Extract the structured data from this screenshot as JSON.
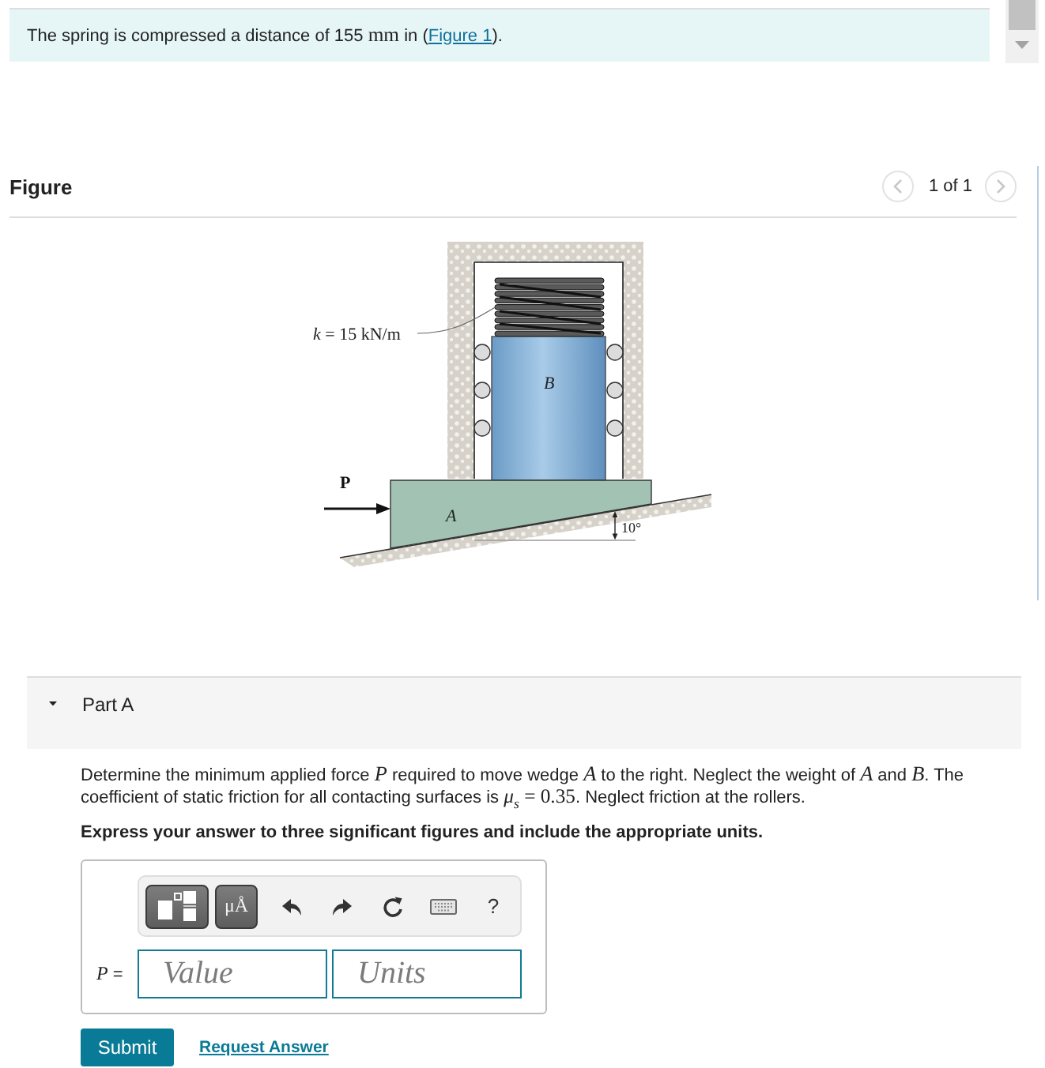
{
  "problem": {
    "segments": [
      {
        "kind": "text",
        "text": "The spring is compressed a distance of 155 "
      },
      {
        "kind": "math",
        "text": "mm"
      },
      {
        "kind": "text",
        "text": " in ("
      },
      {
        "kind": "link",
        "text": "Figure 1"
      },
      {
        "kind": "text",
        "text": ")."
      }
    ]
  },
  "figure": {
    "title": "Figure",
    "pager": {
      "label": "1 of 1",
      "previous_disabled": true,
      "next_disabled": true
    },
    "labels": {
      "stiffness": {
        "variable": "k",
        "value": "= 15 kN/m"
      },
      "block": "B",
      "force": "P",
      "wedge": "A",
      "angle": "10°"
    }
  },
  "part": {
    "title": "Part A",
    "expanded": true,
    "question": [
      {
        "kind": "text",
        "text": "Determine the minimum applied force "
      },
      {
        "kind": "var",
        "text": "P"
      },
      {
        "kind": "text",
        "text": " required to move wedge "
      },
      {
        "kind": "var",
        "text": "A"
      },
      {
        "kind": "text",
        "text": " to the right. Neglect the weight of "
      },
      {
        "kind": "var",
        "text": "A"
      },
      {
        "kind": "text",
        "text": " and "
      },
      {
        "kind": "var",
        "text": "B"
      },
      {
        "kind": "text",
        "text": ". The coefficient of static friction for all contacting surfaces is "
      },
      {
        "kind": "math",
        "text": "*μ*$_{s}$ = 0.35"
      },
      {
        "kind": "text",
        "text": ". Neglect friction at the rollers."
      }
    ],
    "instruction": "Express your answer to three significant figures and include the appropriate units.",
    "toolbar": [
      {
        "kind": "templates"
      },
      {
        "kind": "symbols",
        "label": "μÅ"
      },
      {
        "kind": "undo"
      },
      {
        "kind": "redo"
      },
      {
        "kind": "reset"
      },
      {
        "kind": "keyboard"
      },
      {
        "kind": "help",
        "label": "?"
      }
    ],
    "answer": {
      "variable": "P",
      "sign": "=",
      "value_placeholder": "Value",
      "units_placeholder": "Units"
    },
    "buttons": {
      "submit": "Submit",
      "request_answer": "Request Answer"
    }
  }
}
